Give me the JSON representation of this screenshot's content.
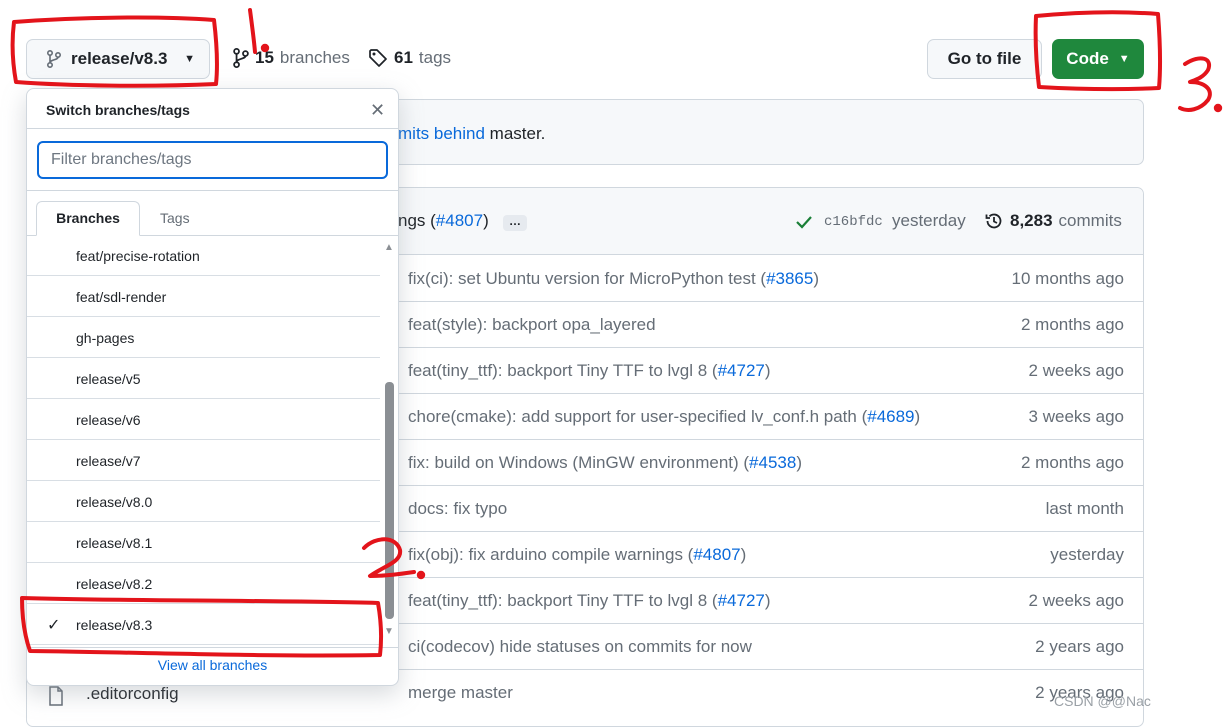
{
  "header": {
    "branch_selector_label": "release/v8.3",
    "branches_count": "15",
    "branches_label": "branches",
    "tags_count": "61",
    "tags_label": "tags",
    "go_to_file_label": "Go to file",
    "code_label": "Code"
  },
  "banner": {
    "behind_link": "mits behind",
    "rest": " master."
  },
  "latest_commit": {
    "message_prefix": "ngs (",
    "issue": "#4807",
    "message_suffix": ")",
    "ellipsis": "…",
    "sha": "c16bfdc",
    "time": "yesterday",
    "commits_count": "8,283",
    "commits_label": "commits"
  },
  "commit_rows": [
    {
      "prefix": "fix(ci): set Ubuntu version for MicroPython test (",
      "issue": "#3865",
      "suffix": ")",
      "time": "10 months ago"
    },
    {
      "prefix": "feat(style): backport opa_layered",
      "issue": "",
      "suffix": "",
      "time": "2 months ago"
    },
    {
      "prefix": "feat(tiny_ttf): backport Tiny TTF to lvgl 8 (",
      "issue": "#4727",
      "suffix": ")",
      "time": "2 weeks ago"
    },
    {
      "prefix": "chore(cmake): add support for user-specified lv_conf.h path (",
      "issue": "#4689",
      "suffix": ")",
      "time": "3 weeks ago"
    },
    {
      "prefix": "fix: build on Windows (MinGW environment) (",
      "issue": "#4538",
      "suffix": ")",
      "time": "2 months ago"
    },
    {
      "prefix": "docs: fix typo",
      "issue": "",
      "suffix": "",
      "time": "last month"
    },
    {
      "prefix": "fix(obj): fix arduino compile warnings (",
      "issue": "#4807",
      "suffix": ")",
      "time": "yesterday"
    },
    {
      "prefix": "feat(tiny_ttf): backport Tiny TTF to lvgl 8 (",
      "issue": "#4727",
      "suffix": ")",
      "time": "2 weeks ago"
    },
    {
      "prefix": "ci(codecov) hide statuses on commits for now",
      "issue": "",
      "suffix": "",
      "time": "2 years ago"
    },
    {
      "prefix": "merge master",
      "issue": "",
      "suffix": "",
      "time": "2 years ago"
    }
  ],
  "last_file": ".editorconfig",
  "dropdown": {
    "title": "Switch branches/tags",
    "filter_placeholder": "Filter branches/tags",
    "tab_branches": "Branches",
    "tab_tags": "Tags",
    "items": [
      {
        "label": "feat/precise-rotation",
        "selected": false
      },
      {
        "label": "feat/sdl-render",
        "selected": false
      },
      {
        "label": "gh-pages",
        "selected": false
      },
      {
        "label": "release/v5",
        "selected": false
      },
      {
        "label": "release/v6",
        "selected": false
      },
      {
        "label": "release/v7",
        "selected": false
      },
      {
        "label": "release/v8.0",
        "selected": false
      },
      {
        "label": "release/v8.1",
        "selected": false
      },
      {
        "label": "release/v8.2",
        "selected": false
      },
      {
        "label": "release/v8.3",
        "selected": true
      }
    ],
    "view_all": "View all branches"
  },
  "annotations": [
    "1.",
    "2.",
    "3."
  ],
  "watermark": "CSDN @@Nac",
  "colors": {
    "accent_blue": "#0969da",
    "code_green": "#1f883d",
    "annotation_red": "#e3141b"
  }
}
